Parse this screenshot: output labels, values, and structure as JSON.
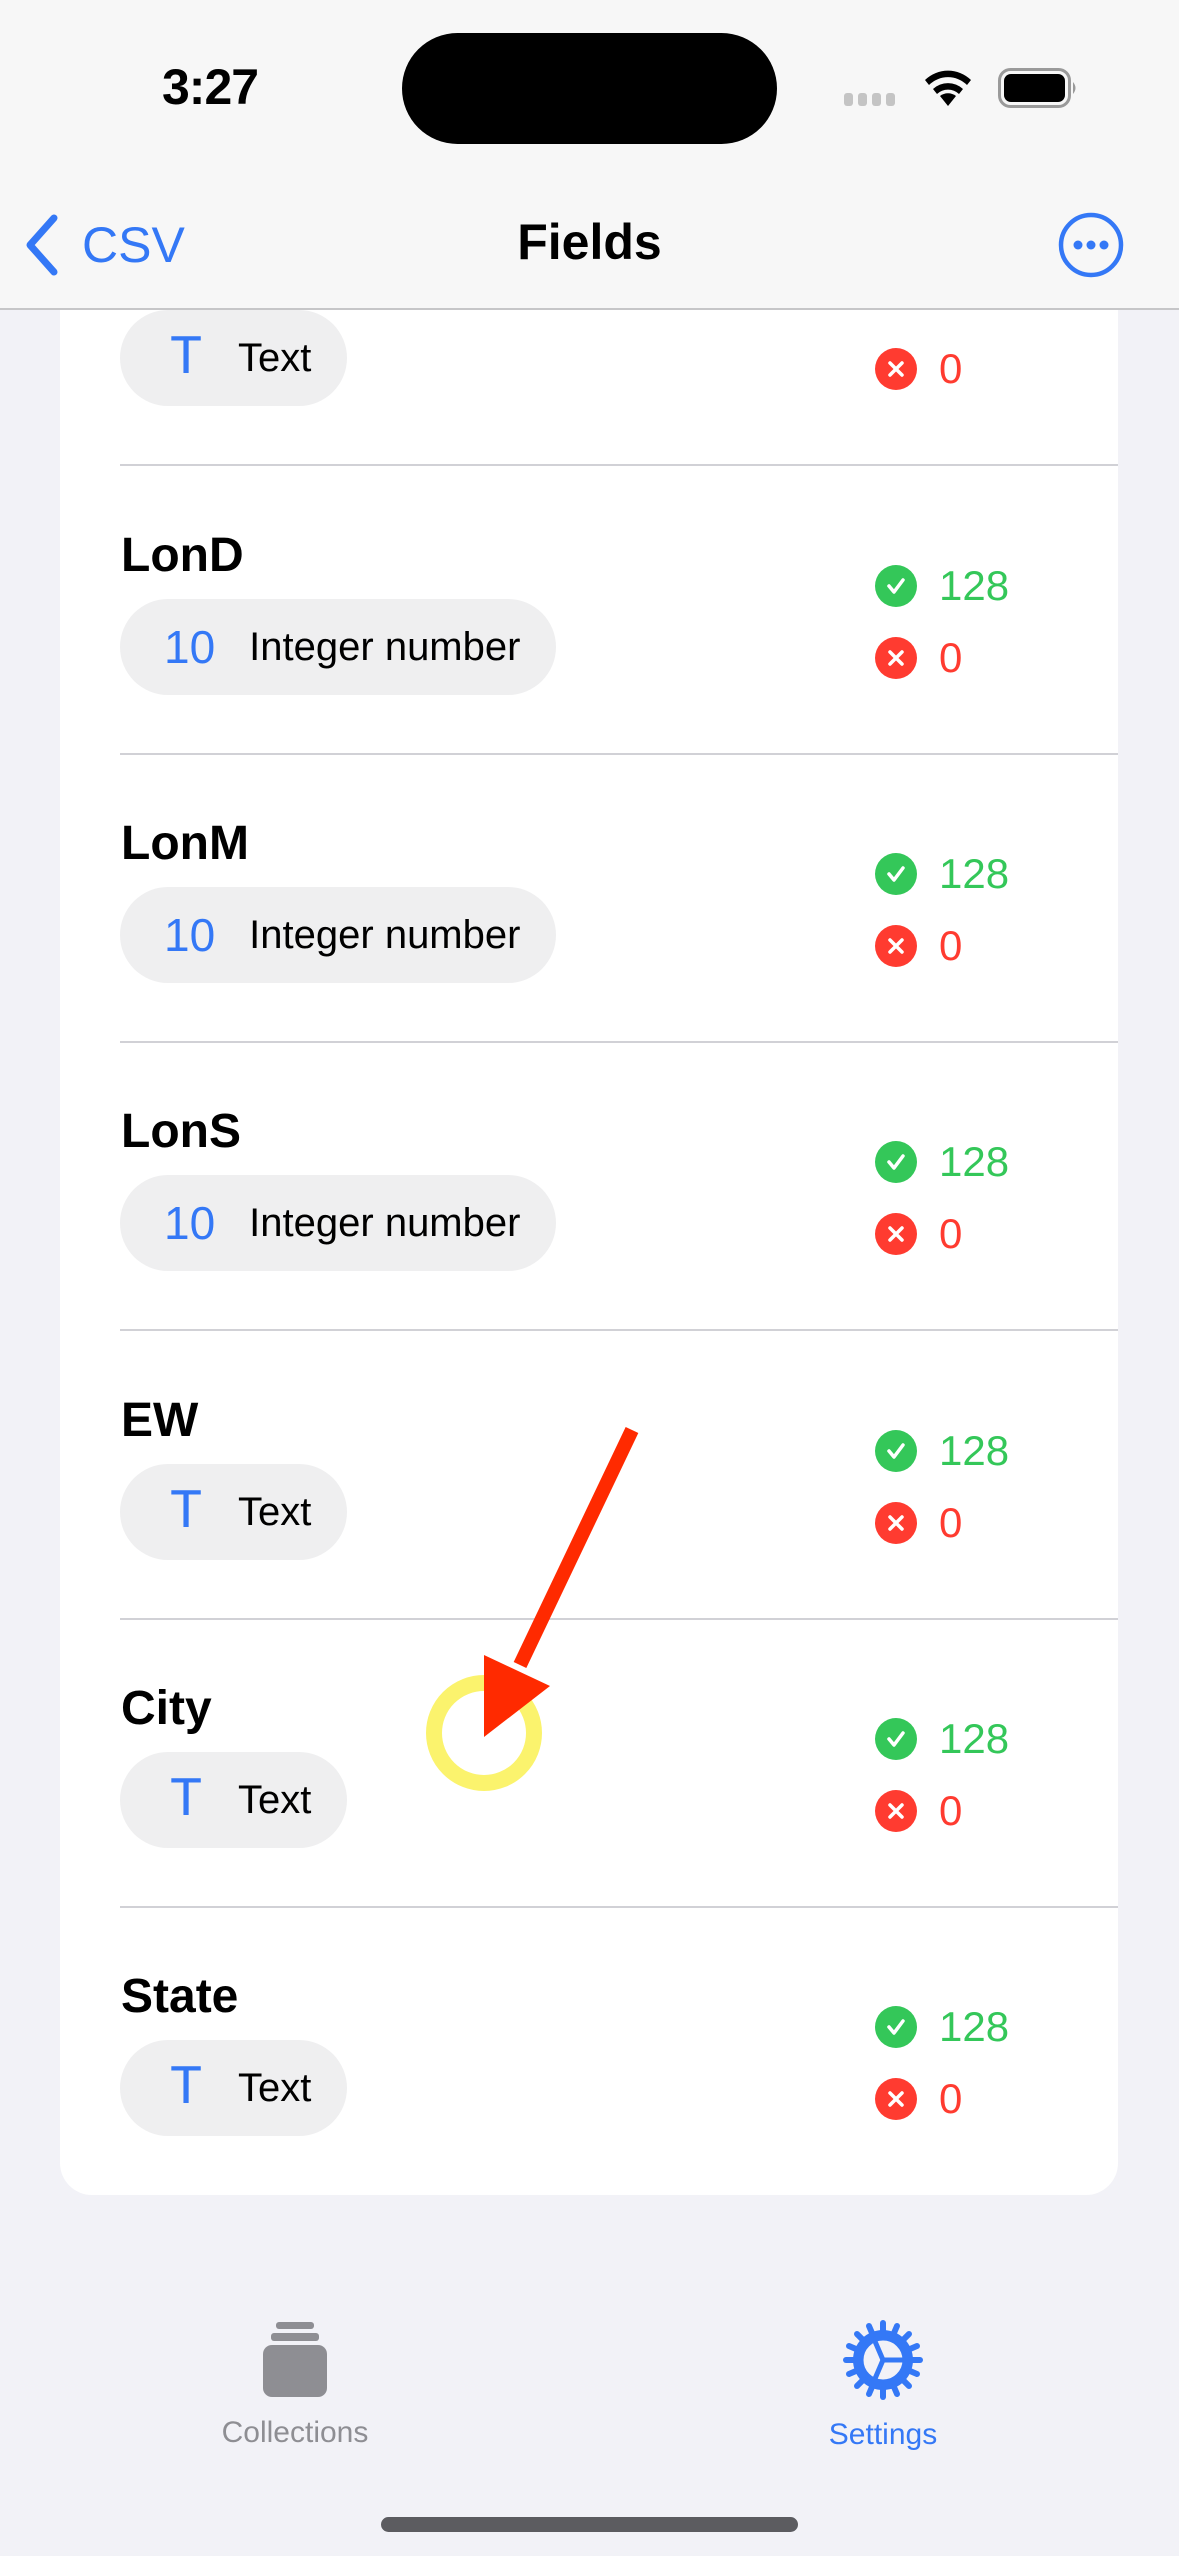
{
  "status_bar": {
    "time": "3:27",
    "icons": [
      "signal-icon",
      "wifi-icon",
      "battery-icon"
    ]
  },
  "nav": {
    "back_label": "CSV",
    "title": "Fields",
    "more_icon": "ellipsis-circle-icon"
  },
  "fields": [
    {
      "name": "",
      "type_icon": "T",
      "type_icon_name": "text-type-icon",
      "type_label": "Text",
      "valid": null,
      "invalid": "0"
    },
    {
      "name": "LonD",
      "type_icon": "10",
      "type_icon_name": "integer-type-icon",
      "type_label": "Integer number",
      "valid": "128",
      "invalid": "0"
    },
    {
      "name": "LonM",
      "type_icon": "10",
      "type_icon_name": "integer-type-icon",
      "type_label": "Integer number",
      "valid": "128",
      "invalid": "0"
    },
    {
      "name": "LonS",
      "type_icon": "10",
      "type_icon_name": "integer-type-icon",
      "type_label": "Integer number",
      "valid": "128",
      "invalid": "0"
    },
    {
      "name": "EW",
      "type_icon": "T",
      "type_icon_name": "text-type-icon",
      "type_label": "Text",
      "valid": "128",
      "invalid": "0"
    },
    {
      "name": "City",
      "type_icon": "T",
      "type_icon_name": "text-type-icon",
      "type_label": "Text",
      "valid": "128",
      "invalid": "0"
    },
    {
      "name": "State",
      "type_icon": "T",
      "type_icon_name": "text-type-icon",
      "type_label": "Text",
      "valid": "128",
      "invalid": "0"
    }
  ],
  "tab_bar": {
    "tabs": [
      {
        "label": "Collections",
        "icon": "collections-icon",
        "active": false
      },
      {
        "label": "Settings",
        "icon": "gear-icon",
        "active": true
      }
    ]
  },
  "colors": {
    "accent": "#3478f6",
    "valid": "#34c759",
    "invalid": "#ff3b30",
    "annotation_arrow": "#ff2a00",
    "annotation_circle": "#fbf36d"
  }
}
